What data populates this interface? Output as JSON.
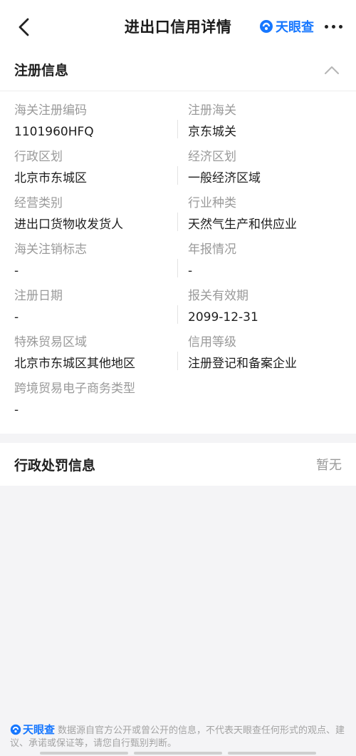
{
  "header": {
    "title": "进出口信用详情",
    "brand": "天眼查"
  },
  "registration": {
    "title": "注册信息",
    "fields": [
      {
        "label": "海关注册编码",
        "value": "1101960HFQ"
      },
      {
        "label": "注册海关",
        "value": "京东城关"
      },
      {
        "label": "行政区划",
        "value": "北京市东城区"
      },
      {
        "label": "经济区划",
        "value": "一般经济区域"
      },
      {
        "label": "经营类别",
        "value": "进出口货物收发货人"
      },
      {
        "label": "行业种类",
        "value": "天然气生产和供应业"
      },
      {
        "label": "海关注销标志",
        "value": "-"
      },
      {
        "label": "年报情况",
        "value": "-"
      },
      {
        "label": "注册日期",
        "value": "-"
      },
      {
        "label": "报关有效期",
        "value": "2099-12-31"
      },
      {
        "label": "特殊贸易区域",
        "value": "北京市东城区其他地区"
      },
      {
        "label": "信用等级",
        "value": "注册登记和备案企业"
      },
      {
        "label": "跨境贸易电子商务类型",
        "value": "-"
      }
    ]
  },
  "penalty": {
    "title": "行政处罚信息",
    "status": "暂无"
  },
  "footer": {
    "brand": "天眼查",
    "disclaimer": "数据源自官方公开或曾公开的信息，不代表天眼查任何形式的观点、建议、承诺或保证等，请您自行甄别判断。"
  },
  "colors": {
    "brand_blue": "#1677ff",
    "label_gray": "#9a9a9a"
  }
}
